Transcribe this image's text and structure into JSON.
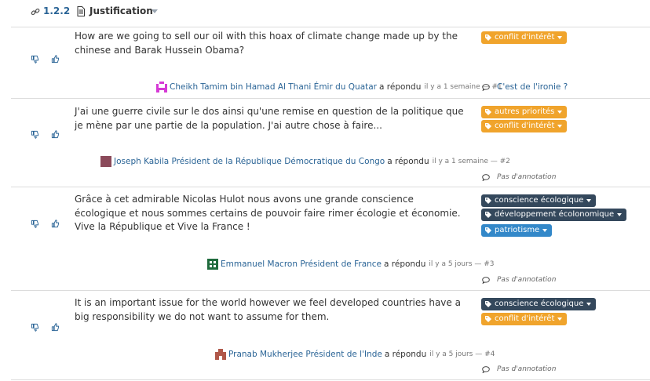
{
  "header": {
    "section_number": "1.2.2",
    "section_title": "Justification"
  },
  "comments": [
    {
      "text": "How are we going to sell our oil with this hoax of climate change made up by the chinese and Barak Hussein Obama?",
      "author": "Cheikh Tamim bin Hamad Al Thani Émir du Quatar",
      "verb": "a répondu",
      "meta": "il y a 1 semaine — #1",
      "avatar_color": "#d63ad6",
      "tags": [
        {
          "label": "conflit d'intérêt",
          "color": "#f0a42c"
        }
      ],
      "annotation": "C'est de l'ironie ?"
    },
    {
      "text": "J'ai une guerre civile sur le dos ainsi qu'une remise en question de la politique que je mène par une partie de la population. J'ai autre chose à faire...",
      "author": "Joseph Kabila Président de la République Démocratique du Congo",
      "verb": "a répondu",
      "meta": "il y a 1 semaine — #2",
      "avatar_color": "#8b4a5a",
      "tags": [
        {
          "label": "autres priorités",
          "color": "#f0a42c"
        },
        {
          "label": "conflit d'intérêt",
          "color": "#f0a42c"
        }
      ],
      "annotation": "Pas d'annotation"
    },
    {
      "text": "Grâce à cet admirable Nicolas Hulot nous avons une grande conscience écologique et nous sommes certains de pouvoir faire rimer écologie et économie. Vive la République et Vive la France !",
      "author": "Emmanuel Macron Président de France",
      "verb": "a répondu",
      "meta": "il y a 5 jours — #3",
      "avatar_color": "#1f6b3d",
      "tags": [
        {
          "label": "conscience écologique",
          "color": "#34485c"
        },
        {
          "label": "développement écolonomique",
          "color": "#34485c"
        },
        {
          "label": "patriotisme",
          "color": "#3388c9"
        }
      ],
      "annotation": "Pas d'annotation"
    },
    {
      "text": "It is an important issue for the world however we feel developed countries have a big responsibility we do not want to assume for them.",
      "author": "Pranab Mukherjee Président de l'Inde",
      "verb": "a répondu",
      "meta": "il y a 5 jours — #4",
      "avatar_color": "#b0584a",
      "tags": [
        {
          "label": "conscience écologique",
          "color": "#34485c"
        },
        {
          "label": "conflit d'intérêt",
          "color": "#f0a42c"
        }
      ],
      "annotation": "Pas d'annotation"
    }
  ]
}
